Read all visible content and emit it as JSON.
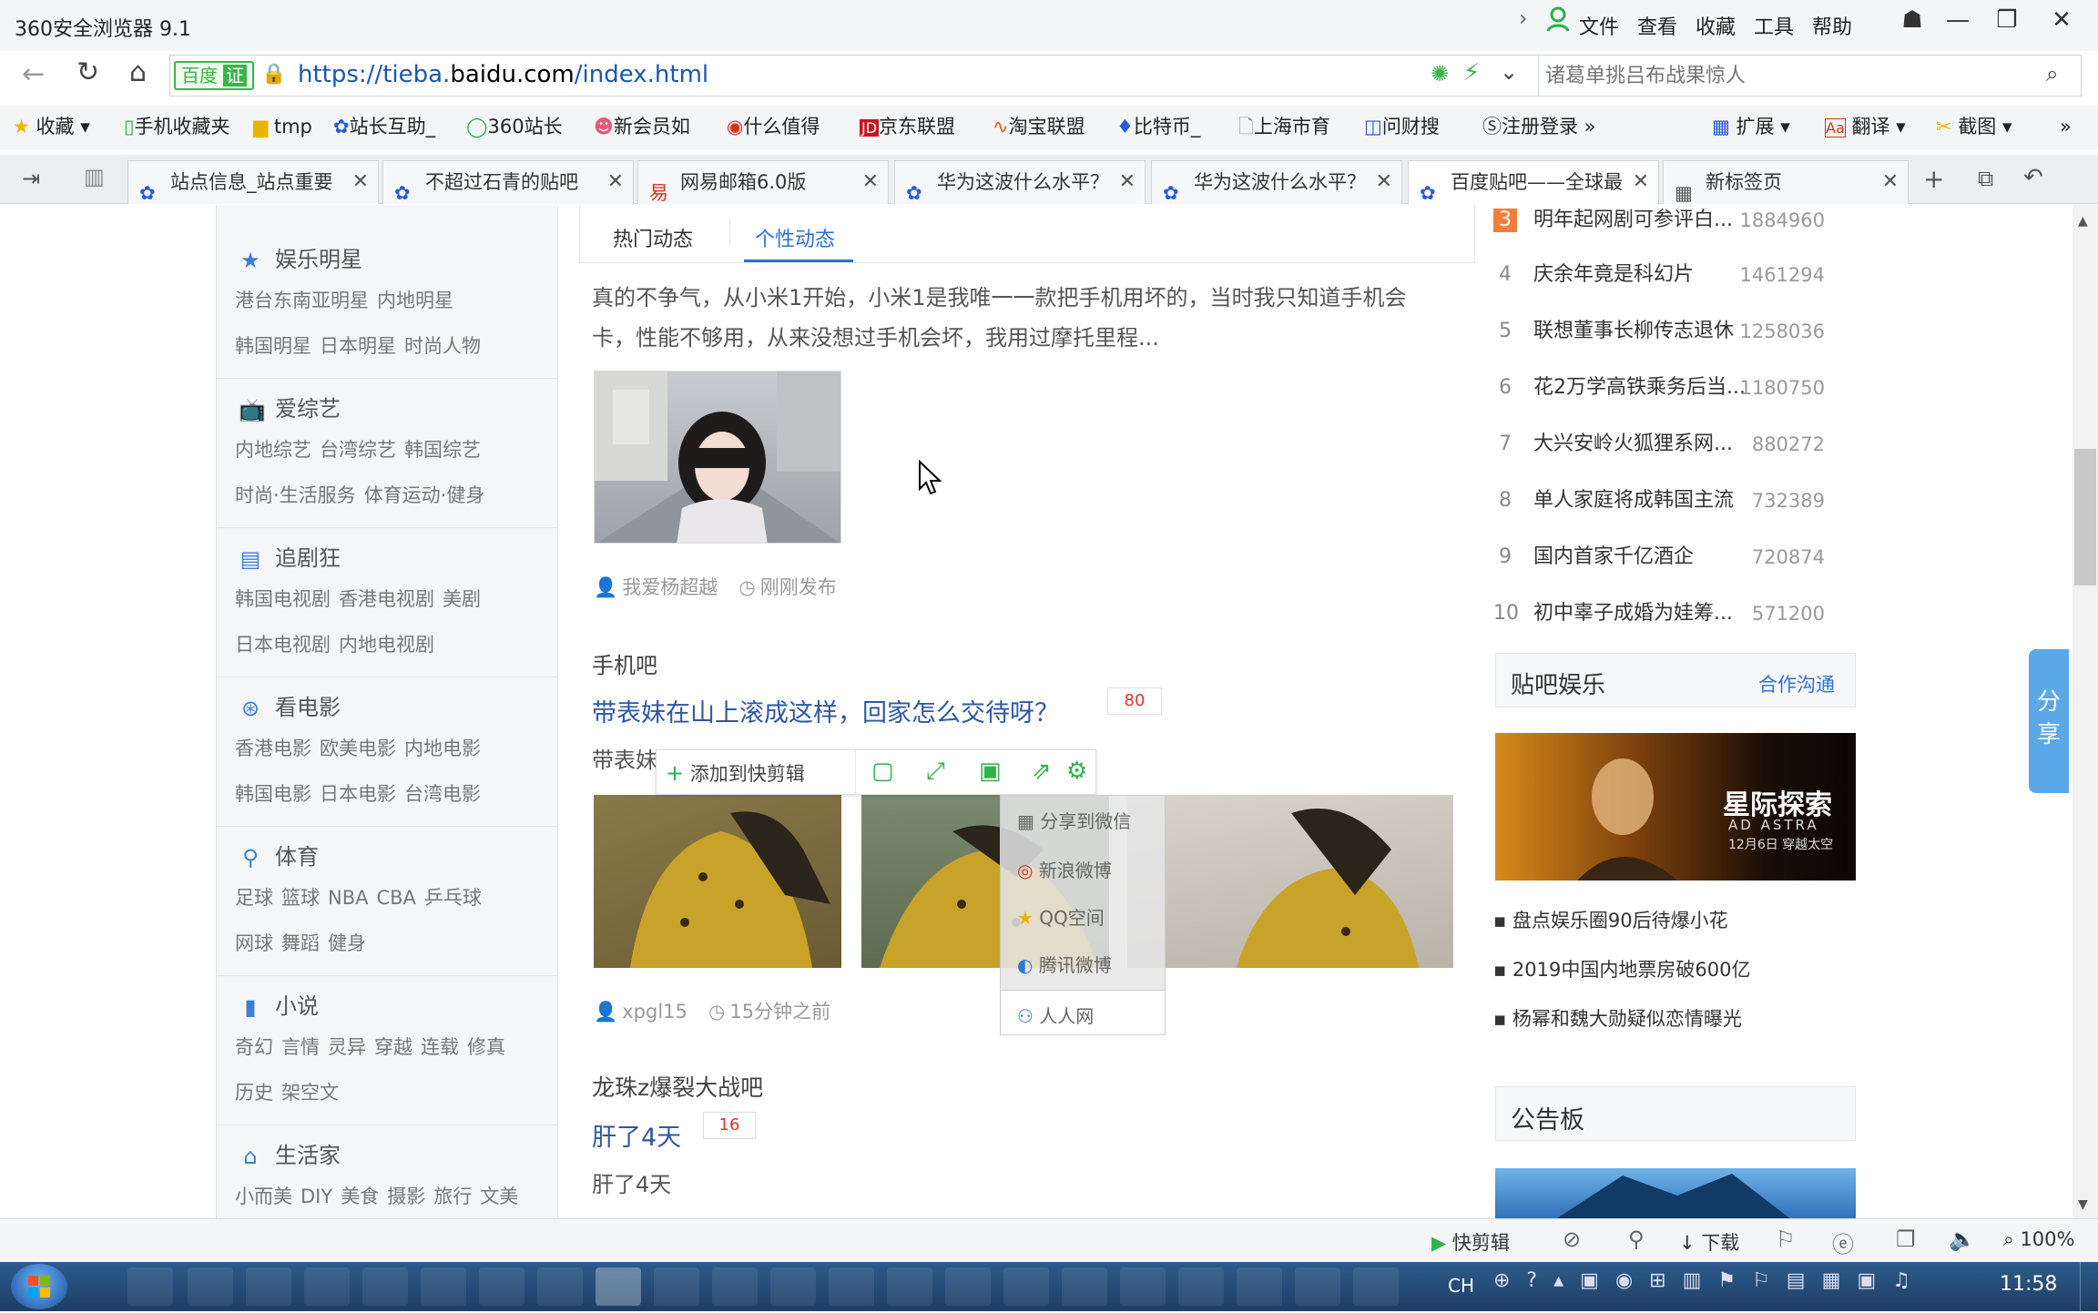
{
  "window": {
    "title": "360安全浏览器 9.1",
    "menu": [
      "文件",
      "查看",
      "收藏",
      "工具",
      "帮助"
    ]
  },
  "address": {
    "prefix": "https://tieba.",
    "domain": "baidu.com",
    "path": "/index.html",
    "site_badge": "百度",
    "cert": "证",
    "search_placeholder": "诸葛单挑吕布战果惊人"
  },
  "bookmarks": [
    "收藏",
    "手机收藏夹",
    "tmp",
    "站长互助_",
    "360站长",
    "新会员如",
    "什么值得",
    "京东联盟",
    "淘宝联盟",
    "比特币_",
    "上海市育",
    "问财搜",
    "注册登录"
  ],
  "bookmarks_right": [
    "扩展",
    "翻译",
    "截图"
  ],
  "tabs": [
    "站点信息_站点重要",
    "不超过石青的贴吧",
    "网易邮箱6.0版",
    "华为这波什么水平？",
    "华为这波什么水平？",
    "百度贴吧——全球最",
    "新标签页"
  ],
  "sidebar": [
    {
      "title": "娱乐明星",
      "icon": "star-icon",
      "rows": [
        [
          "港台东南亚明星",
          "内地明星"
        ],
        [
          "韩国明星",
          "日本明星",
          "时尚人物"
        ]
      ]
    },
    {
      "title": "爱综艺",
      "icon": "tv-icon",
      "rows": [
        [
          "内地综艺",
          "台湾综艺",
          "韩国综艺"
        ],
        [
          "时尚·生活服务",
          "体育运动·健身"
        ]
      ]
    },
    {
      "title": "追剧狂",
      "icon": "film-icon",
      "rows": [
        [
          "韩国电视剧",
          "香港电视剧",
          "美剧"
        ],
        [
          "日本电视剧",
          "内地电视剧"
        ]
      ]
    },
    {
      "title": "看电影",
      "icon": "reel-icon",
      "rows": [
        [
          "香港电影",
          "欧美电影",
          "内地电影"
        ],
        [
          "韩国电影",
          "日本电影",
          "台湾电影"
        ]
      ]
    },
    {
      "title": "体育",
      "icon": "sport-icon",
      "rows": [
        [
          "足球",
          "篮球",
          "NBA",
          "CBA",
          "乒乓球"
        ],
        [
          "网球",
          "舞蹈",
          "健身"
        ]
      ]
    },
    {
      "title": "小说",
      "icon": "book-icon",
      "rows": [
        [
          "奇幻",
          "言情",
          "灵异",
          "穿越",
          "连载",
          "修真"
        ],
        [
          "历史",
          "架空文"
        ]
      ]
    },
    {
      "title": "生活家",
      "icon": "home-icon",
      "rows": [
        [
          "小而美",
          "DIY",
          "美食",
          "摄影",
          "旅行",
          "文美"
        ]
      ]
    }
  ],
  "feed": {
    "tabs": [
      "热门动态",
      "个性动态"
    ],
    "post1": {
      "text_line1": "真的不争气，从小米1开始，小米1是我唯一一款把手机用坏的，当时我只知道手机会",
      "text_line2": "卡，性能不够用，从来没想过手机会坏，我用过摩托里程...",
      "user": "我爱杨超越",
      "time": "刚刚发布"
    },
    "post2": {
      "forum": "手机吧",
      "title": "带表妹在山上滚成这样，回家怎么交待呀？",
      "replies": "80",
      "snippet": "带表妹",
      "user": "xpgl15",
      "time": "15分钟之前"
    },
    "post3": {
      "forum": "龙珠z爆裂大战吧",
      "title": "肝了4天",
      "replies": "16",
      "snippet": "肝了4天"
    },
    "toolbar": {
      "add_label": "添加到快剪辑"
    },
    "share_menu": [
      "分享到微信",
      "新浪微博",
      "QQ空间",
      "腾讯微博",
      "人人网"
    ]
  },
  "hotlist": [
    {
      "rank": "3",
      "title": "明年起网剧可参评白...",
      "value": "1884960"
    },
    {
      "rank": "4",
      "title": "庆余年竟是科幻片",
      "value": "1461294"
    },
    {
      "rank": "5",
      "title": "联想董事长柳传志退休",
      "value": "1258036"
    },
    {
      "rank": "6",
      "title": "花2万学高铁乘务后当...",
      "value": "1180750"
    },
    {
      "rank": "7",
      "title": "大兴安岭火狐狸系网...",
      "value": "880272"
    },
    {
      "rank": "8",
      "title": "单人家庭将成韩国主流",
      "value": "732389"
    },
    {
      "rank": "9",
      "title": "国内首家千亿酒企",
      "value": "720874"
    },
    {
      "rank": "10",
      "title": "初中辜子成婚为娃筹...",
      "value": "571200"
    }
  ],
  "ent": {
    "title": "贴吧娱乐",
    "link": "合作沟通",
    "banner_title": "星际探索",
    "banner_sub": "AD ASTRA",
    "banner_date": "12月6日 穿越太空",
    "items": [
      "盘点娱乐圈90后待爆小花",
      "2019中国内地票房破600亿",
      "杨幂和魏大勋疑似恋情曝光"
    ]
  },
  "notice": {
    "title": "公告板"
  },
  "float_share": "分享",
  "status": {
    "items": [
      "快剪辑",
      "下载"
    ],
    "zoom": "100%"
  },
  "taskbar": {
    "tray": "CH",
    "clock": "11:58"
  }
}
